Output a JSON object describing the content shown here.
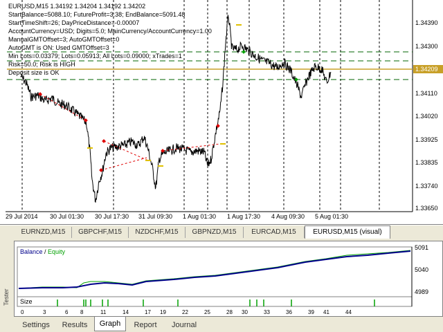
{
  "chart": {
    "overlay_lines": [
      "EURUSD,M15  1.34192 1.34204 1.34192 1.34202",
      "StartBalance=5088.10; FutureProfit=3.38; EndBalance=5091.48",
      "StartTimeShift=26; DayPriceDistance=-0.00007",
      "AccountCurrency=USD; Digits=5.0; MainCurrency/AccountCurrency=1.00",
      "ManualGMTOffset=3; AutoGMTOffset=0",
      "AutoGMT is ON: Used GMTOffset=3",
      "Min Lots=0.03379; Lots=0.05913; All Lots=0.09000; xTrades=1",
      "Risk=50.0; Risk is HIGH",
      "Deposit size is OK"
    ],
    "price_axis": [
      "1.34390",
      "1.34300",
      "1.34209",
      "1.34110",
      "1.34020",
      "1.33925",
      "1.33835",
      "1.33740",
      "1.33650"
    ],
    "current_price": "1.34209",
    "time_axis": [
      "29 Jul 2014",
      "30 Jul 01:30",
      "30 Jul 17:30",
      "31 Jul 09:30",
      "1 Aug 01:30",
      "1 Aug 17:30",
      "4 Aug 09:30",
      "5 Aug 01:30"
    ]
  },
  "symbol_tabs": [
    "EURNZD,M15",
    "GBPCHF,M15",
    "NZDCHF,M15",
    "GBPNZD,M15",
    "EURCAD,M15",
    "EURUSD,M15 (visual)"
  ],
  "graph": {
    "legend_balance": "Balance",
    "legend_sep": " / ",
    "legend_equity": "Equity",
    "y_axis": [
      "5091",
      "5040",
      "4989"
    ],
    "size_label": "Size",
    "x_axis": [
      "0",
      "3",
      "6",
      "8",
      "11",
      "14",
      "17",
      "19",
      "22",
      "25",
      "28",
      "30",
      "33",
      "36",
      "39",
      "41",
      "44"
    ],
    "colors": {
      "balance": "#00008b",
      "equity": "#00a000",
      "size": "#00a000"
    }
  },
  "tester_label": "Tester",
  "bottom_tabs": [
    "Settings",
    "Results",
    "Graph",
    "Report",
    "Journal"
  ],
  "active_bottom_tab": "Graph"
}
